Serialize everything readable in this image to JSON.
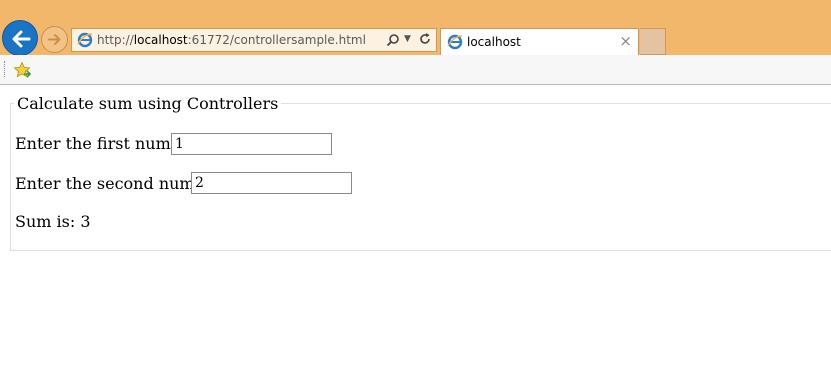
{
  "browser": {
    "address_scheme": "http://",
    "address_host": "localhost",
    "address_path": ":61772/controllersample.html",
    "tab_title": "localhost",
    "tab_close": "×",
    "accent_color": "#f3b76c"
  },
  "page": {
    "legend": "Calculate sum using Controllers",
    "first_label": "Enter the first number:",
    "first_value": "1",
    "second_label": "Enter the second number:",
    "second_value": "2",
    "sum_label": "Sum is:",
    "sum_value": "3"
  }
}
